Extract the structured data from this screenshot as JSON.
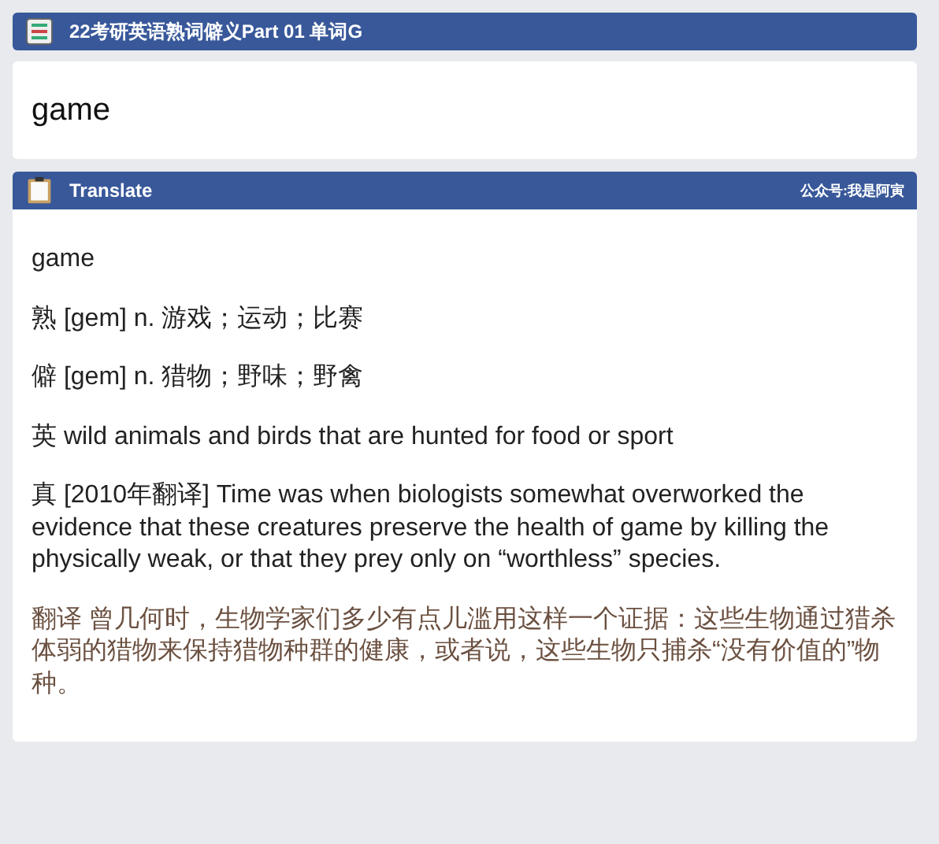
{
  "header": {
    "title": "22考研英语熟词僻义Part 01 单词G"
  },
  "word_card": {
    "word": "game"
  },
  "translate_header": {
    "title": "Translate",
    "note": "公众号:我是阿寅"
  },
  "entries": [
    {
      "kind": "word",
      "text": "game"
    },
    {
      "kind": "definition",
      "text": "熟 [gem] n. 游戏；运动；比赛"
    },
    {
      "kind": "definition",
      "text": "僻 [gem] n. 猎物；野味；野禽"
    },
    {
      "kind": "definition",
      "text": "英 wild animals and birds that are hunted for food or sport"
    },
    {
      "kind": "definition",
      "text": "真 [2010年翻译] Time was when biologists somewhat overworked the evidence that these creatures preserve the health of game by killing the physically weak, or that they prey only on “worthless” species."
    },
    {
      "kind": "translation",
      "text": "翻译 曾几何时，生物学家们多少有点儿滥用这样一个证据：这些生物通过猎杀体弱的猎物来保持猎物种群的健康，或者说，这些生物只捕杀“没有价值的”物种。"
    }
  ]
}
